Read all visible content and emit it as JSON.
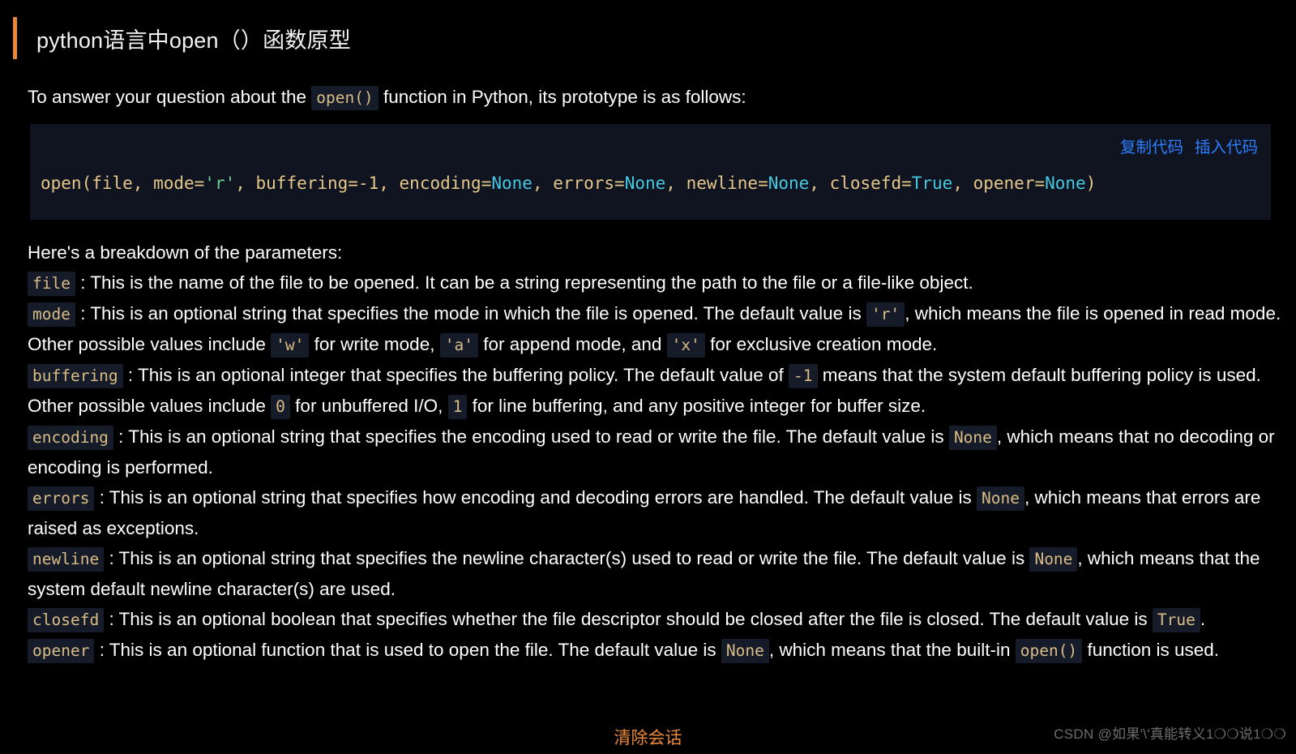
{
  "header": {
    "title": "python语言中open（）函数原型",
    "accent_color": "#e8883a"
  },
  "intro": {
    "before": "To answer your question about the ",
    "code": "open()",
    "after": " function in Python, its prototype is as follows:"
  },
  "code_block": {
    "copy_label": "复制代码",
    "insert_label": "插入代码",
    "action_color": "#2b7fff",
    "background": "#0f1420",
    "language": "python",
    "tokens": [
      {
        "t": "open(file, mode=",
        "c": "plain"
      },
      {
        "t": "'r'",
        "c": "string"
      },
      {
        "t": ", buffering=",
        "c": "plain"
      },
      {
        "t": "-1",
        "c": "number"
      },
      {
        "t": ", encoding=",
        "c": "plain"
      },
      {
        "t": "None",
        "c": "const"
      },
      {
        "t": ", errors=",
        "c": "plain"
      },
      {
        "t": "None",
        "c": "const"
      },
      {
        "t": ", newline=",
        "c": "plain"
      },
      {
        "t": "None",
        "c": "const"
      },
      {
        "t": ", closefd=",
        "c": "plain"
      },
      {
        "t": "True",
        "c": "const"
      },
      {
        "t": ", opener=",
        "c": "plain"
      },
      {
        "t": "None",
        "c": "const"
      },
      {
        "t": ")",
        "c": "plain"
      }
    ],
    "plain_text": "open(file, mode='r', buffering=-1, encoding=None, errors=None, newline=None, closefd=True, opener=None)"
  },
  "breakdown": {
    "heading": "Here's a breakdown of the parameters:",
    "params": [
      {
        "name": "file",
        "parts": [
          {
            "type": "text",
            "v": " : This is the name of the file to be opened. It can be a string representing the path to the file or a file-like object."
          }
        ]
      },
      {
        "name": "mode",
        "parts": [
          {
            "type": "text",
            "v": " : This is an optional string that specifies the mode in which the file is opened. The default value is "
          },
          {
            "type": "code",
            "v": "'r'"
          },
          {
            "type": "text",
            "v": ", which means the file is opened in read mode. Other possible values include "
          },
          {
            "type": "code",
            "v": "'w'"
          },
          {
            "type": "text",
            "v": " for write mode, "
          },
          {
            "type": "code",
            "v": "'a'"
          },
          {
            "type": "text",
            "v": " for append mode, and "
          },
          {
            "type": "code",
            "v": "'x'"
          },
          {
            "type": "text",
            "v": " for exclusive creation mode."
          }
        ]
      },
      {
        "name": "buffering",
        "parts": [
          {
            "type": "text",
            "v": " : This is an optional integer that specifies the buffering policy. The default value of "
          },
          {
            "type": "code",
            "v": "-1"
          },
          {
            "type": "text",
            "v": " means that the system default buffering policy is used. Other possible values include "
          },
          {
            "type": "code",
            "v": "0"
          },
          {
            "type": "text",
            "v": " for unbuffered I/O, "
          },
          {
            "type": "code",
            "v": "1"
          },
          {
            "type": "text",
            "v": " for line buffering, and any positive integer for buffer size."
          }
        ]
      },
      {
        "name": "encoding",
        "parts": [
          {
            "type": "text",
            "v": " : This is an optional string that specifies the encoding used to read or write the file. The default value is "
          },
          {
            "type": "code",
            "v": "None"
          },
          {
            "type": "text",
            "v": ", which means that no decoding or encoding is performed."
          }
        ]
      },
      {
        "name": "errors",
        "parts": [
          {
            "type": "text",
            "v": " : This is an optional string that specifies how encoding and decoding errors are handled. The default value is "
          },
          {
            "type": "code",
            "v": "None"
          },
          {
            "type": "text",
            "v": ", which means that errors are raised as exceptions."
          }
        ]
      },
      {
        "name": "newline",
        "parts": [
          {
            "type": "text",
            "v": " : This is an optional string that specifies the newline character(s) used to read or write the file. The default value is "
          },
          {
            "type": "code",
            "v": "None"
          },
          {
            "type": "text",
            "v": ", which means that the system default newline character(s) are used."
          }
        ]
      },
      {
        "name": "closefd",
        "parts": [
          {
            "type": "text",
            "v": " : This is an optional boolean that specifies whether the file descriptor should be closed after the file is closed. The default value is "
          },
          {
            "type": "code",
            "v": "True"
          },
          {
            "type": "text",
            "v": "."
          }
        ]
      },
      {
        "name": "opener",
        "parts": [
          {
            "type": "text",
            "v": " : This is an optional function that is used to open the file. The default value is "
          },
          {
            "type": "code",
            "v": "None"
          },
          {
            "type": "text",
            "v": ", which means that the built-in "
          },
          {
            "type": "code",
            "v": "open()"
          },
          {
            "type": "text",
            "v": " function is used."
          }
        ]
      }
    ]
  },
  "footer": {
    "clear_session_label": "清除会话",
    "clear_session_color": "#e8883a",
    "watermark": "CSDN @如果'\\'真能转义1❍❍说1❍❍"
  }
}
